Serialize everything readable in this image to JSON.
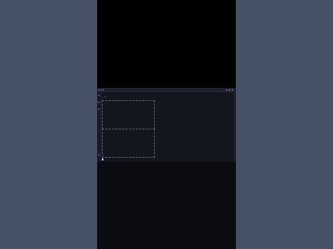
{
  "window": {
    "title": "",
    "tabs": [
      "",
      "",
      ""
    ]
  },
  "terminal": {
    "prompt_symbol": "~",
    "prompt_arrow": "❯",
    "prompt_text": "",
    "status_text": ""
  },
  "colors": {
    "page_bg": "#455164",
    "terminal_bg": "#14161f",
    "accent_blue": "#7aa2f7",
    "accent_green": "#9ece6a"
  }
}
